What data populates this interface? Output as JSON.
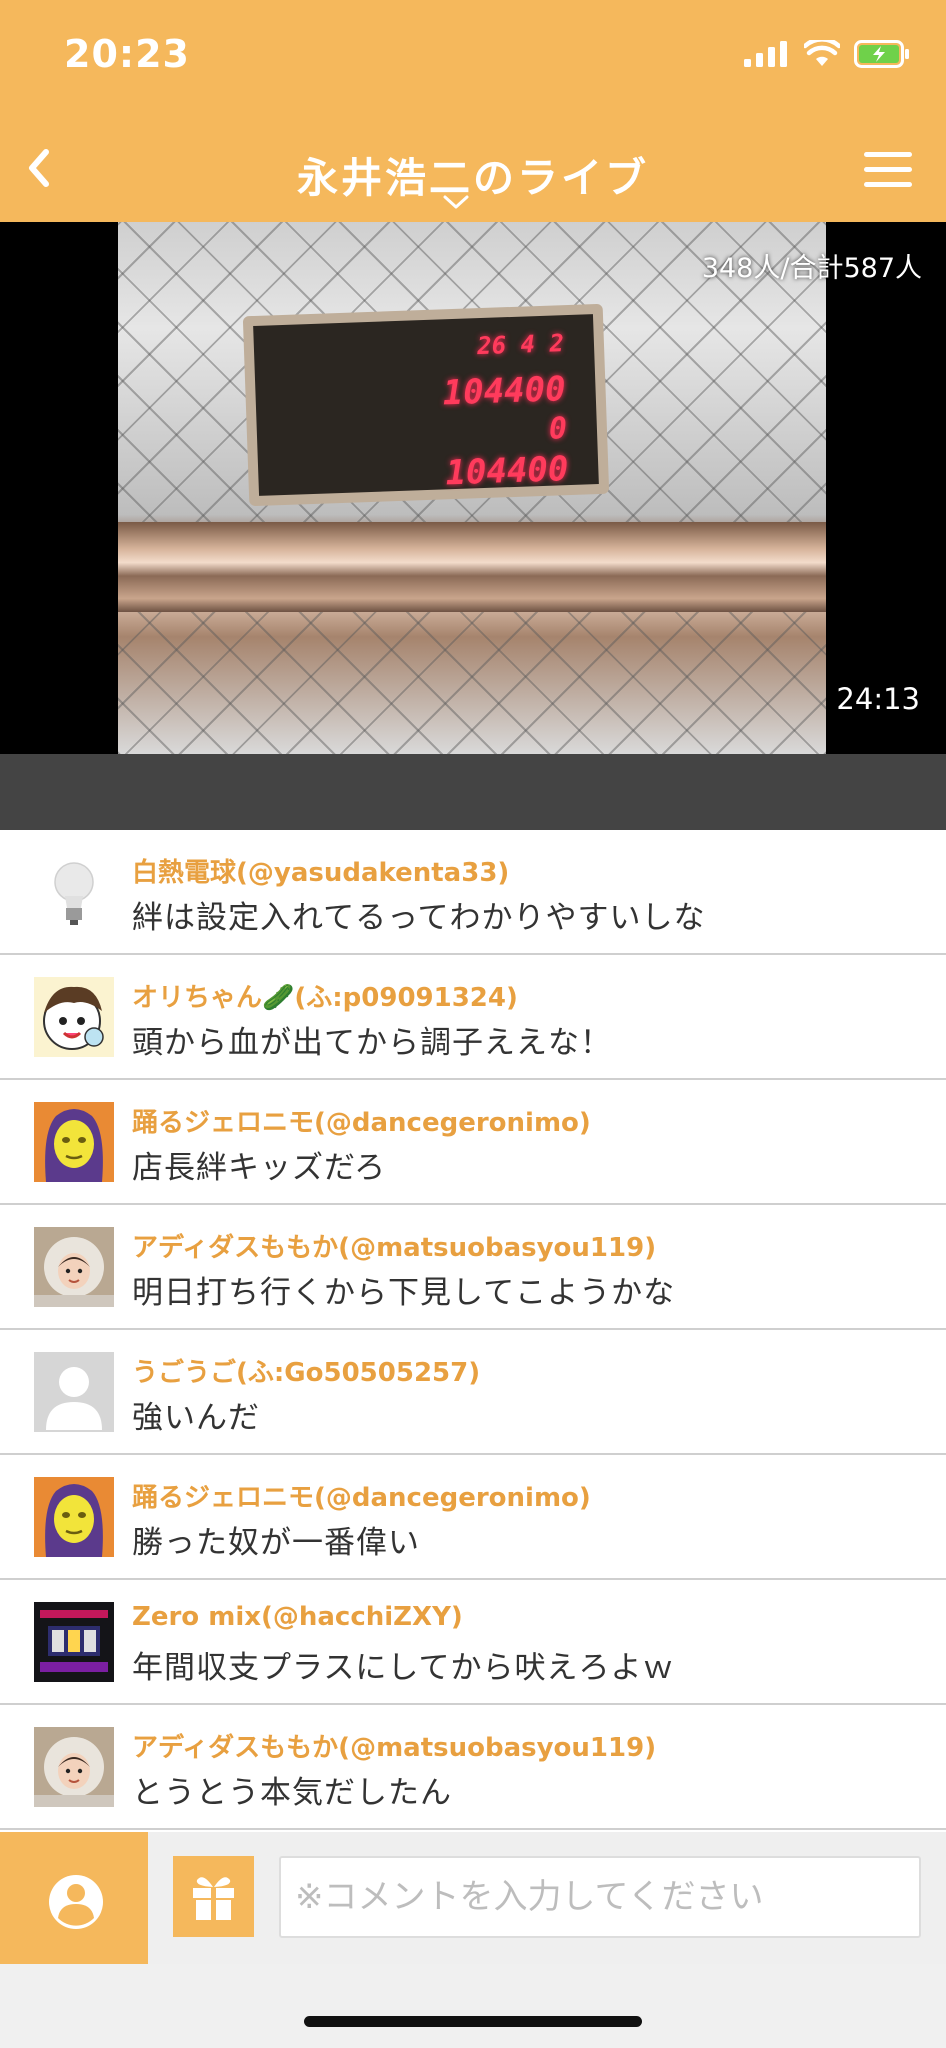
{
  "status_bar": {
    "time": "20:23"
  },
  "nav": {
    "title": "永井浩二のライブ"
  },
  "video": {
    "viewers": "348人/合計587人",
    "duration": "24:13",
    "counter_rows": [
      "26  4  2",
      "104400",
      "0",
      "104400"
    ]
  },
  "comments": [
    {
      "user": "白熱電球(@yasudakenta33)",
      "text": "絆は設定入れてるってわかりやすいしな",
      "avatar": "lightbulb-avatar"
    },
    {
      "user": "オリちゃん🥒(ふ:p09091324)",
      "text": "頭から血が出てから調子ええな！",
      "avatar": "cartoon-boy-avatar"
    },
    {
      "user": "踊るジェロニモ(@dancegeronimo)",
      "text": "店長絆キッズだろ",
      "avatar": "yellow-face-avatar"
    },
    {
      "user": "アディダスももか(@matsuobasyou119)",
      "text": "明日打ち行くから下見してこようかな",
      "avatar": "girl-photo-avatar"
    },
    {
      "user": "うごうご(ふ:Go50505257)",
      "text": "強いんだ",
      "avatar": "default-user-avatar"
    },
    {
      "user": "踊るジェロニモ(@dancegeronimo)",
      "text": "勝った奴が一番偉い",
      "avatar": "yellow-face-avatar"
    },
    {
      "user": "Zero mix(@hacchiZXY)",
      "text": "年間収支プラスにしてから吠えろよｗ",
      "avatar": "slot-screen-avatar"
    },
    {
      "user": "アディダスももか(@matsuobasyou119)",
      "text": "とうとう本気だしたん",
      "avatar": "girl-photo-avatar"
    }
  ],
  "input": {
    "placeholder": "※コメントを入力してください"
  },
  "colors": {
    "accent": "#F5B85C",
    "username": "#E8A040"
  }
}
